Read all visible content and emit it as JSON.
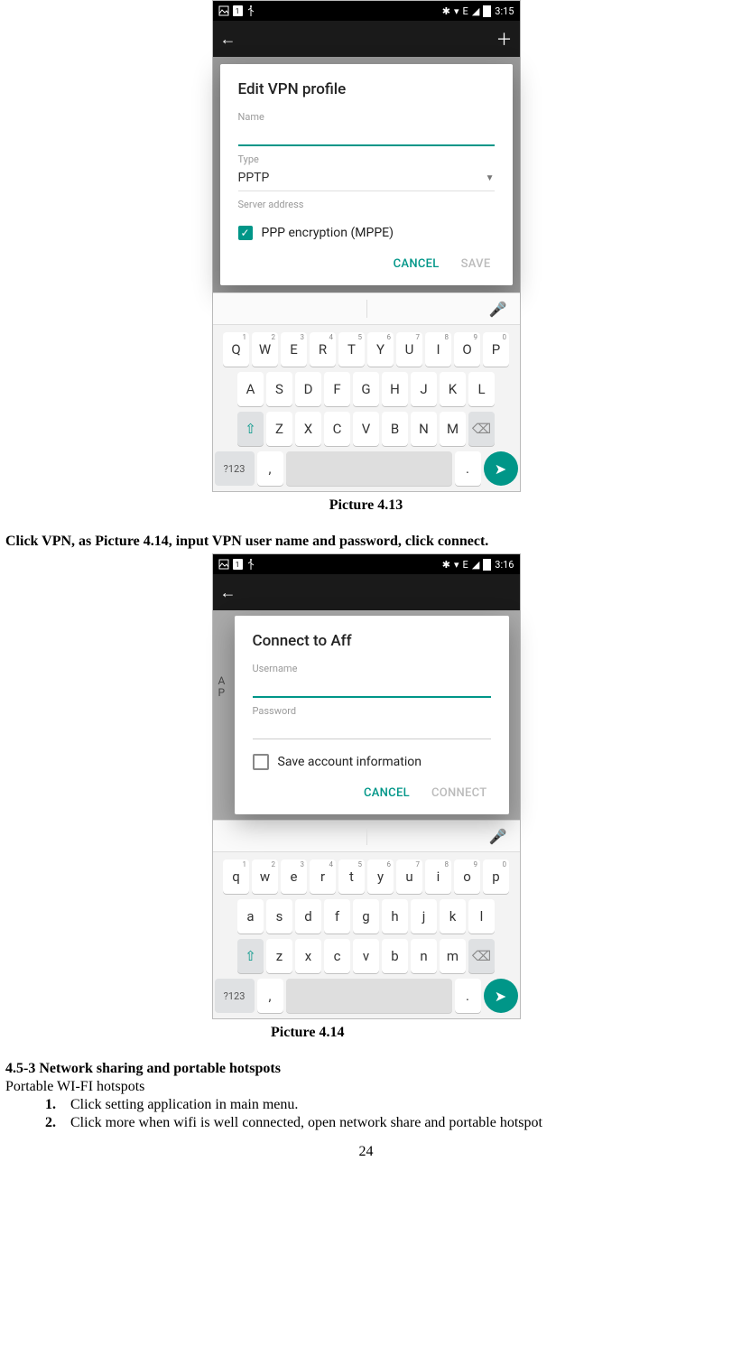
{
  "page_number": "24",
  "captions": {
    "p413": "Picture 4.13",
    "p414": "Picture 4.14"
  },
  "text": {
    "instr_vpn": "Click VPN, as Picture 4.14, input VPN user name and password, click connect.",
    "section_head": "4.5-3 Network sharing and portable hotspots",
    "sub": "Portable WI-FI hotspots",
    "li1": "Click setting application in main menu.",
    "li2": "Click more when wifi is well connected, open network share and portable hotspot"
  },
  "phone1": {
    "status": {
      "time": "3:15",
      "net": "E",
      "card": "1",
      "bt": "bluetooth",
      "sig": "signal",
      "wifi": "wifi",
      "bat": "battery"
    },
    "dialog": {
      "title": "Edit VPN profile",
      "name_label": "Name",
      "type_label": "Type",
      "type_value": "PPTP",
      "server_label": "Server address",
      "checkbox_label": "PPP encryption (MPPE)",
      "cancel": "CANCEL",
      "save": "SAVE"
    },
    "keyboard": {
      "row1": [
        "Q",
        "W",
        "E",
        "R",
        "T",
        "Y",
        "U",
        "I",
        "O",
        "P"
      ],
      "row1sup": [
        "1",
        "2",
        "3",
        "4",
        "5",
        "6",
        "7",
        "8",
        "9",
        "0"
      ],
      "row2": [
        "A",
        "S",
        "D",
        "F",
        "G",
        "H",
        "J",
        "K",
        "L"
      ],
      "row3": [
        "Z",
        "X",
        "C",
        "V",
        "B",
        "N",
        "M"
      ],
      "sym": "?123",
      "comma": ",",
      "dot": "."
    }
  },
  "phone2": {
    "status": {
      "time": "3:16",
      "net": "E"
    },
    "left_text": "A\nP",
    "dialog": {
      "title": "Connect to Aff",
      "user_label": "Username",
      "pass_label": "Password",
      "checkbox_label": "Save account information",
      "cancel": "CANCEL",
      "connect": "CONNECT"
    },
    "keyboard": {
      "row1": [
        "q",
        "w",
        "e",
        "r",
        "t",
        "y",
        "u",
        "i",
        "o",
        "p"
      ],
      "row1sup": [
        "1",
        "2",
        "3",
        "4",
        "5",
        "6",
        "7",
        "8",
        "9",
        "0"
      ],
      "row2": [
        "a",
        "s",
        "d",
        "f",
        "g",
        "h",
        "j",
        "k",
        "l"
      ],
      "row3": [
        "z",
        "x",
        "c",
        "v",
        "b",
        "n",
        "m"
      ],
      "sym": "?123",
      "comma": ",",
      "dot": "."
    }
  }
}
